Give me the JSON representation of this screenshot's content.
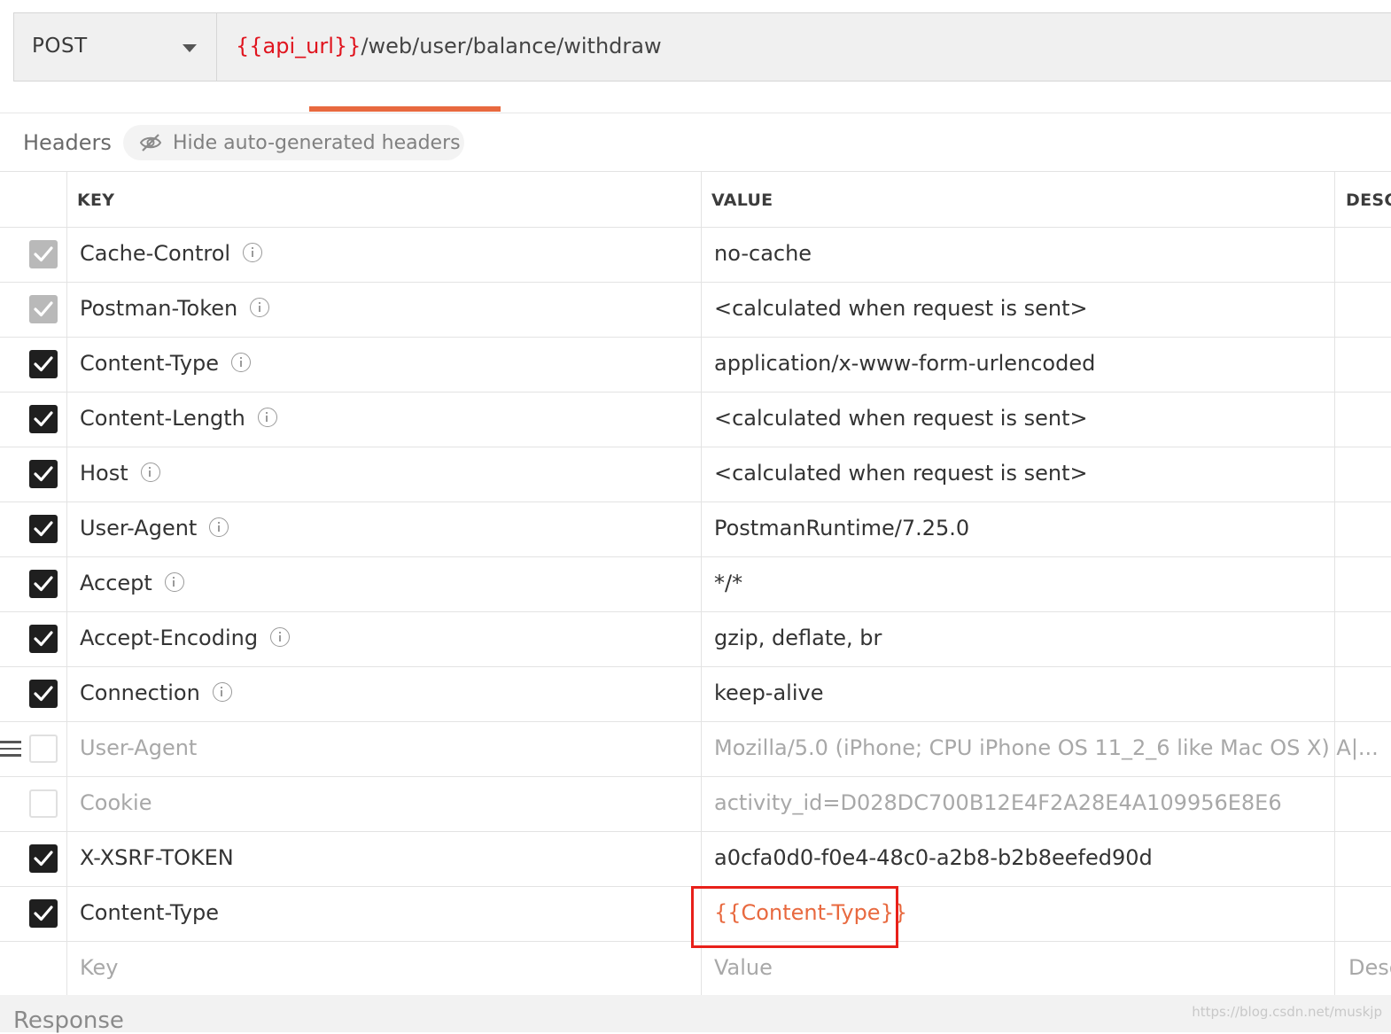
{
  "request": {
    "method": "POST",
    "url_variable": "{{api_url}}",
    "url_path": "/web/user/balance/withdraw"
  },
  "headers_section": {
    "title": "Headers",
    "hide_auto_label": "Hide auto-generated headers"
  },
  "table": {
    "columns": {
      "key": "KEY",
      "value": "VALUE",
      "description": "DESC"
    },
    "rows": [
      {
        "key": "Cache-Control",
        "value": "no-cache",
        "state": "auto",
        "info": true
      },
      {
        "key": "Postman-Token",
        "value": "<calculated when request is sent>",
        "state": "auto",
        "info": true
      },
      {
        "key": "Content-Type",
        "value": "application/x-www-form-urlencoded",
        "state": "on",
        "info": true
      },
      {
        "key": "Content-Length",
        "value": "<calculated when request is sent>",
        "state": "on",
        "info": true
      },
      {
        "key": "Host",
        "value": "<calculated when request is sent>",
        "state": "on",
        "info": true
      },
      {
        "key": "User-Agent",
        "value": "PostmanRuntime/7.25.0",
        "state": "on",
        "info": true
      },
      {
        "key": "Accept",
        "value": "*/*",
        "state": "on",
        "info": true
      },
      {
        "key": "Accept-Encoding",
        "value": "gzip, deflate, br",
        "state": "on",
        "info": true
      },
      {
        "key": "Connection",
        "value": "keep-alive",
        "state": "on",
        "info": true
      },
      {
        "key": "User-Agent",
        "value": "Mozilla/5.0 (iPhone; CPU iPhone OS 11_2_6 like Mac OS X) A|...",
        "state": "off",
        "info": false,
        "drag": true
      },
      {
        "key": "Cookie",
        "value": "activity_id=D028DC700B12E4F2A28E4A109956E8E6",
        "state": "off",
        "info": false
      },
      {
        "key": "X-XSRF-TOKEN",
        "value": "a0cfa0d0-f0e4-48c0-a2b8-b2b8eefed90d",
        "state": "on",
        "info": false
      },
      {
        "key": "Content-Type",
        "value": "{{Content-Type}}",
        "state": "on",
        "info": false,
        "variable": true
      }
    ],
    "placeholders": {
      "key": "Key",
      "value": "Value",
      "description": "Desc"
    }
  },
  "response": {
    "label": "Response"
  },
  "watermark": "https://blog.csdn.net/muskjp",
  "colors": {
    "accent": "#e8693f",
    "url_variable": "#e0141e",
    "highlight": "#e8201a"
  }
}
